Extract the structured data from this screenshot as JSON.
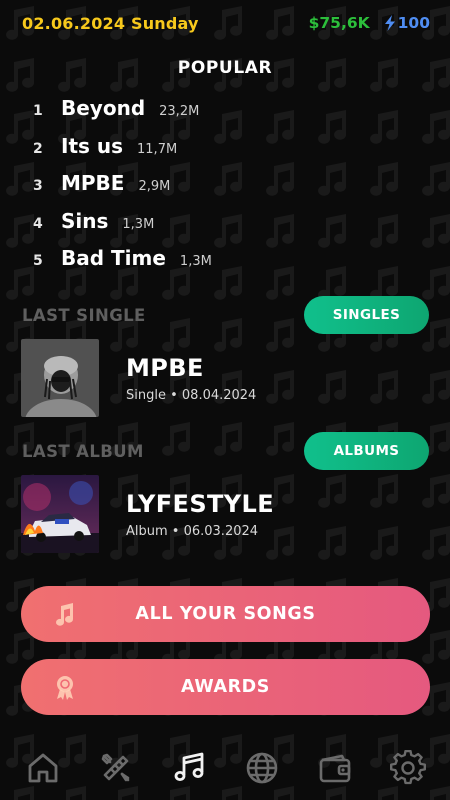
{
  "status": {
    "date": "02.06.2024 Sunday",
    "money": "$75,6K",
    "energy": "100"
  },
  "popular": {
    "title": "POPULAR",
    "songs": [
      {
        "rank": "1",
        "name": "Beyond",
        "plays": "23,2M"
      },
      {
        "rank": "2",
        "name": "Its us",
        "plays": "11,7M"
      },
      {
        "rank": "3",
        "name": "MPBE",
        "plays": "2,9M"
      },
      {
        "rank": "4",
        "name": "Sins",
        "plays": "1,3M"
      },
      {
        "rank": "5",
        "name": "Bad Time",
        "plays": "1,3M"
      }
    ]
  },
  "last_single": {
    "label": "LAST SINGLE",
    "button": "SINGLES",
    "title": "MPBE",
    "meta": "Single • 08.04.2024"
  },
  "last_album": {
    "label": "LAST ALBUM",
    "button": "ALBUMS",
    "title": "LYFESTYLE",
    "meta": "Album • 06.03.2024"
  },
  "actions": {
    "all_songs": "ALL YOUR SONGS",
    "awards": "AWARDS"
  },
  "nav": {
    "items": [
      {
        "icon": "home-icon",
        "active": false
      },
      {
        "icon": "tools-icon",
        "active": false
      },
      {
        "icon": "music-note-icon",
        "active": true
      },
      {
        "icon": "globe-icon",
        "active": false
      },
      {
        "icon": "wallet-icon",
        "active": false
      },
      {
        "icon": "gear-icon",
        "active": false
      }
    ]
  },
  "colors": {
    "date": "#f7c91c",
    "money": "#2cbf3b",
    "energy": "#4f8df2",
    "green_button": "#10c08c",
    "pink_button_start": "#f07070",
    "pink_button_end": "#e5597f"
  }
}
